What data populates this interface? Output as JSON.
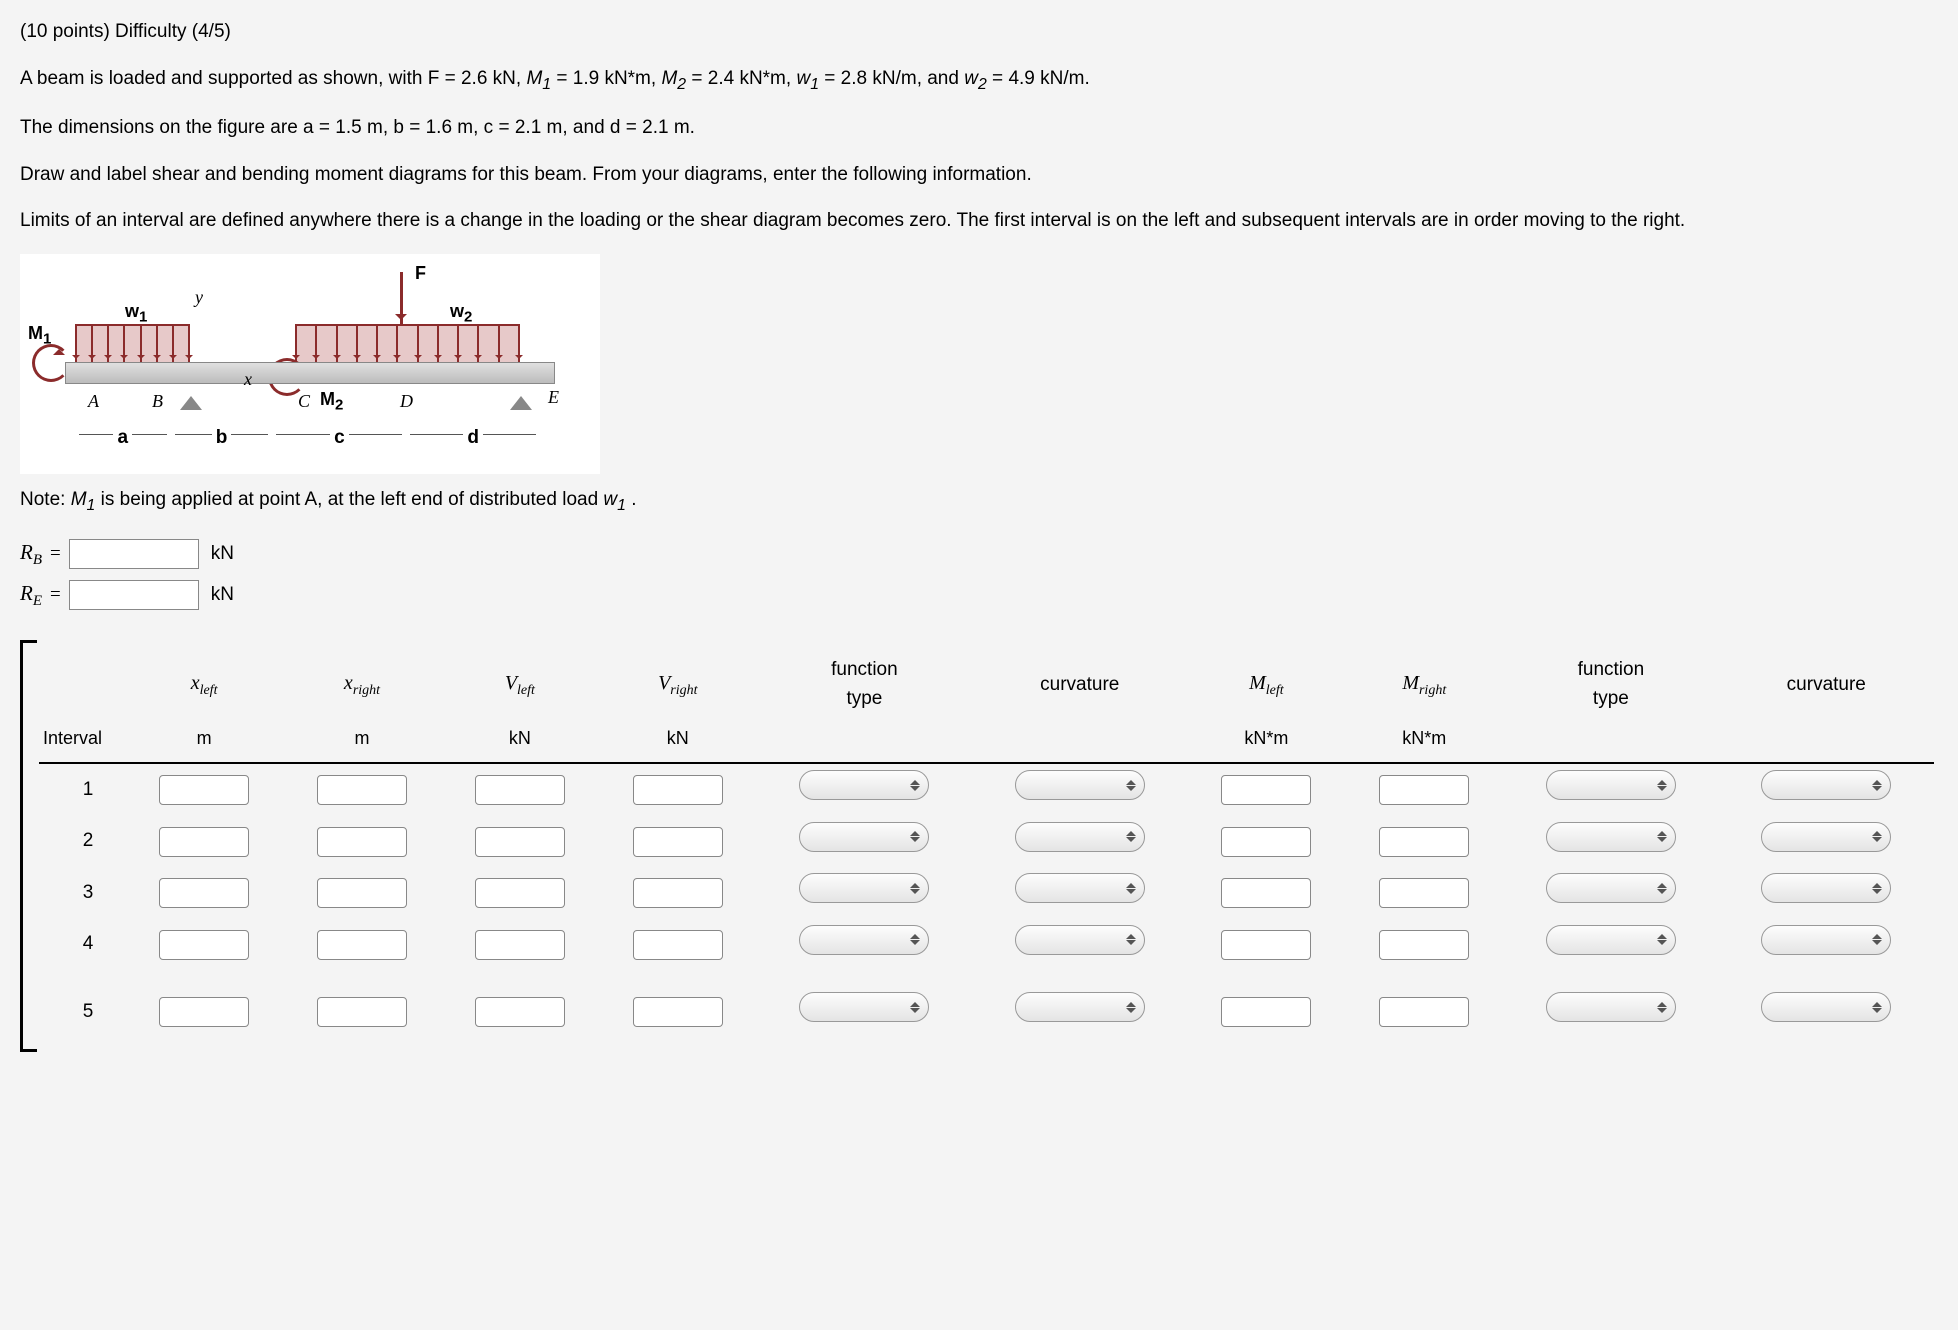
{
  "header": "(10 points) Difficulty (4/5)",
  "para1_a": "A beam is loaded and supported as shown, with F = ",
  "F": "2.6 kN",
  "para1_b": ", ",
  "M1v": "1.9 kN*m",
  "M2v": "2.4 kN*m",
  "w1v": "2.8 kN/m",
  "w2v": "4.9 kN/m",
  "para2_a": "The dimensions on the figure are a = ",
  "a": "1.5 m",
  "b": "1.6 m",
  "c": "2.1 m",
  "d": "2.1 m",
  "para3": "Draw and label shear and bending moment diagrams for this beam. From your diagrams, enter the following information.",
  "para4": "Limits of an interval are defined anywhere there is a change in the loading or the shear diagram becomes zero. The first interval is on the left and subsequent intervals are in order moving to the right.",
  "fig": {
    "F": "F",
    "w1": "w",
    "w2": "w",
    "M1": "M",
    "M2": "M",
    "A": "A",
    "B": "B",
    "C": "C",
    "D": "D",
    "E": "E",
    "da": "a",
    "db": "b",
    "dc": "c",
    "dd": "d",
    "y": "y",
    "x": "x"
  },
  "note_a": "Note: ",
  "note_b": " is being applied at point A, at the left end of distributed load ",
  "reactions": {
    "RB": "R",
    "RE": "R",
    "unit": "kN",
    "eq": " = "
  },
  "table": {
    "interval": "Interval",
    "xleft": "x",
    "xleft_s": "left",
    "xright": "x",
    "xright_s": "right",
    "Vleft": "V",
    "Vleft_s": "left",
    "Vright": "V",
    "Vright_s": "right",
    "ftype": "function type",
    "curv": "curvature",
    "Mleft": "M",
    "Mleft_s": "left",
    "Mright": "M",
    "Mright_s": "right",
    "u_m": "m",
    "u_kN": "kN",
    "u_kNm": "kN*m",
    "rows": [
      "1",
      "2",
      "3",
      "4",
      "5"
    ]
  }
}
